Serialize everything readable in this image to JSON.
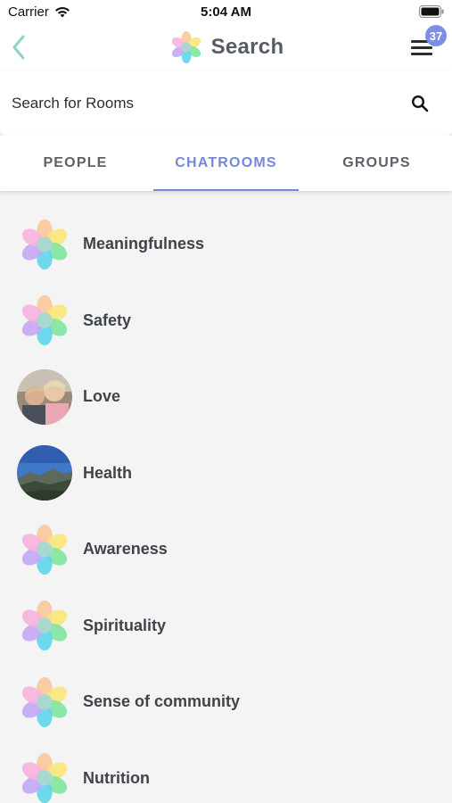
{
  "status_bar": {
    "carrier": "Carrier",
    "time": "5:04 AM"
  },
  "nav": {
    "title": "Search",
    "badge_count": "37"
  },
  "search": {
    "placeholder": "Search for Rooms"
  },
  "tabs": [
    {
      "label": "PEOPLE",
      "active": false
    },
    {
      "label": "CHATROOMS",
      "active": true
    },
    {
      "label": "GROUPS",
      "active": false
    }
  ],
  "rooms": [
    {
      "name": "Meaningfulness",
      "avatar": "flower-icon"
    },
    {
      "name": "Safety",
      "avatar": "flower-icon"
    },
    {
      "name": "Love",
      "avatar": "photo-children"
    },
    {
      "name": "Health",
      "avatar": "photo-mountains"
    },
    {
      "name": "Awareness",
      "avatar": "flower-icon"
    },
    {
      "name": "Spirituality",
      "avatar": "flower-icon"
    },
    {
      "name": "Sense of community",
      "avatar": "flower-icon"
    },
    {
      "name": "Nutrition",
      "avatar": "flower-icon"
    }
  ],
  "colors": {
    "accent": "#7688dc",
    "badge": "#7d8ee6",
    "back_arrow": "#8fd3c6",
    "background": "#f4f4f5"
  }
}
